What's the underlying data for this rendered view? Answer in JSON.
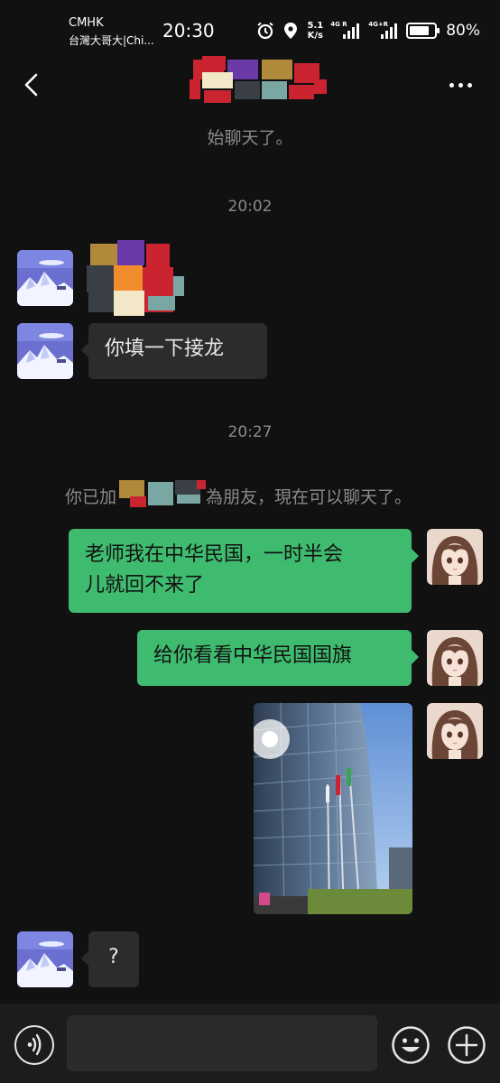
{
  "status_bar": {
    "carrier_top": "CMHK",
    "carrier_bottom": "台灣大哥大|Chi...",
    "time": "20:30",
    "speed_value": "5.1",
    "speed_unit": "K/s",
    "signal1_label": "4G R",
    "signal2_label": "4G+R",
    "battery": "80%",
    "battery_level": 0.8
  },
  "header": {
    "title": "",
    "back_icon": "chevron-left-icon",
    "more_icon": "more-dots-icon"
  },
  "messages": {
    "system_top": "始聊天了。",
    "time1": "20:02",
    "incoming_text1": "你填一下接龙",
    "time2": "20:27",
    "system_friend_prefix": "你已加",
    "system_friend_suffix": "為朋友，現在可以聊天了。",
    "outgoing_text1_line1": "老师我在中华民国，一时半会",
    "outgoing_text1_line2": "儿就回不来了",
    "outgoing_text2": "给你看看中华民国国旗",
    "incoming_text2": "?"
  },
  "input_bar": {
    "voice_icon": "voice-icon",
    "emoji_icon": "emoji-icon",
    "plus_icon": "plus-icon"
  },
  "colors": {
    "background": "#111111",
    "bubble_in": "#2c2c2c",
    "bubble_out": "#3fbb6f",
    "system_text": "#8a8a8a"
  }
}
